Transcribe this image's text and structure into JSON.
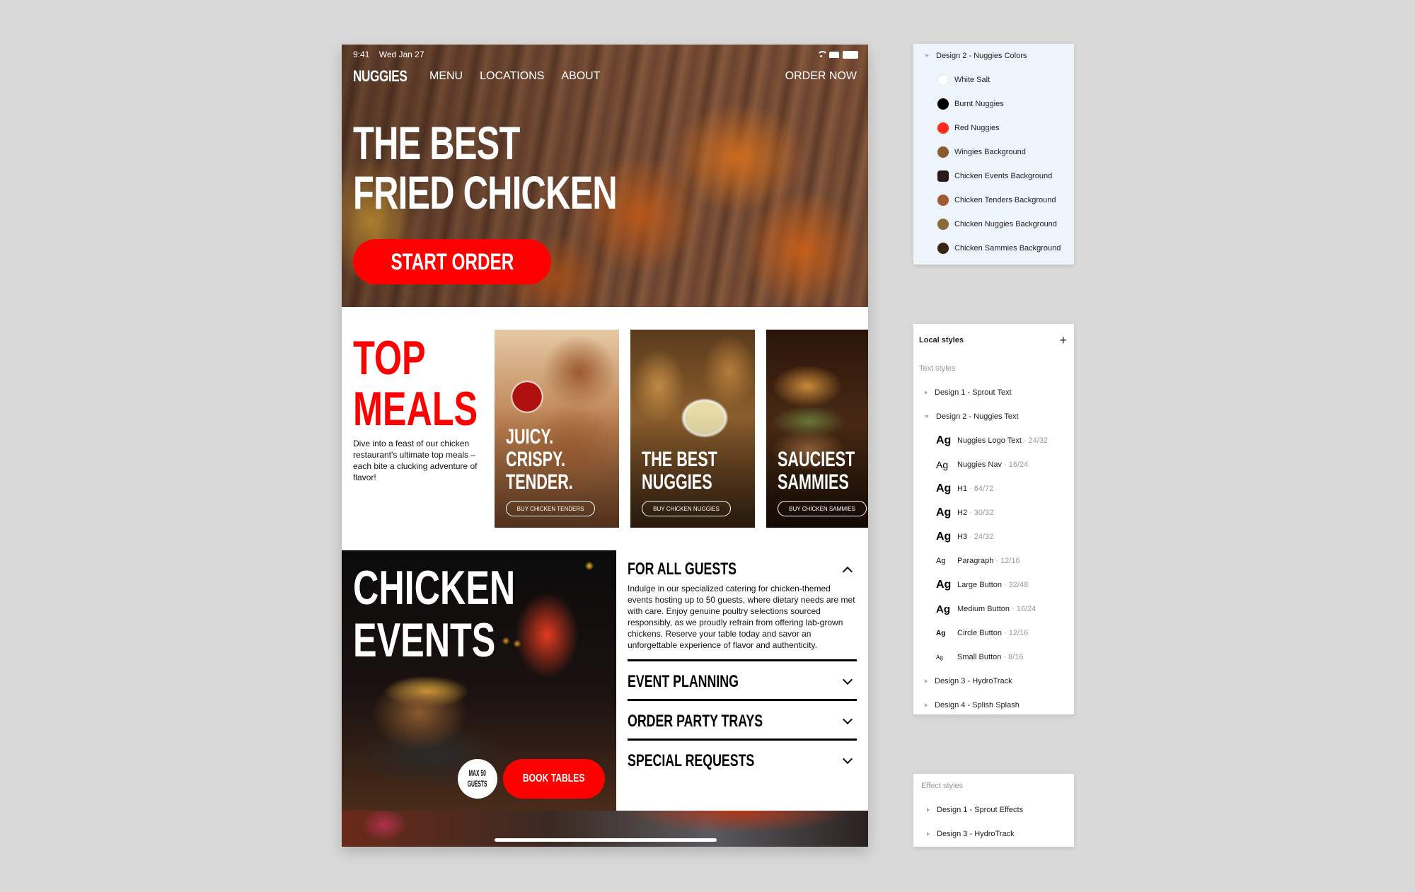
{
  "device": {
    "status_bar": {
      "time": "9:41",
      "date": "Wed Jan 27"
    },
    "nav": {
      "logo": "NUGGIES",
      "links": [
        "MENU",
        "LOCATIONS",
        "ABOUT"
      ],
      "cta": "ORDER NOW"
    },
    "hero": {
      "title_line1": "THE BEST",
      "title_line2": "FRIED CHICKEN",
      "button": "START ORDER"
    },
    "top_meals": {
      "title_line1": "TOP",
      "title_line2": "MEALS",
      "description": "Dive into a feast of our chicken restaurant's ultimate top meals – each bite a clucking adventure of flavor!",
      "cards": [
        {
          "title_lines": [
            "JUICY.",
            "CRISPY.",
            "TENDER."
          ],
          "button": "BUY CHICKEN TENDERS"
        },
        {
          "title_lines": [
            "THE BEST",
            "NUGGIES"
          ],
          "button": "BUY CHICKEN NUGGIES"
        },
        {
          "title_lines": [
            "SAUCIEST",
            "SAMMIES"
          ],
          "button": "BUY CHICKEN SAMMIES"
        }
      ]
    },
    "events": {
      "title_line1": "CHICKEN",
      "title_line2": "EVENTS",
      "badge_line1": "MAX 50",
      "badge_line2": "GUESTS",
      "button": "BOOK TABLES",
      "accordion": [
        {
          "title": "FOR ALL GUESTS",
          "open": true,
          "body": "Indulge in our specialized catering for chicken-themed events hosting up to 50 guests, where dietary needs are met with care. Enjoy genuine poultry selections sourced responsibly, as we proudly refrain from offering lab-grown chickens. Reserve your table today and savor an unforgettable experience of flavor and authenticity."
        },
        {
          "title": "EVENT PLANNING",
          "open": false
        },
        {
          "title": "ORDER PARTY TRAYS",
          "open": false
        },
        {
          "title": "SPECIAL REQUESTS",
          "open": false
        }
      ]
    }
  },
  "colors_panel": {
    "group": "Design 2 - Nuggies Colors",
    "items": [
      {
        "name": "White Salt",
        "color": "#ffffff"
      },
      {
        "name": "Burnt Nuggies",
        "color": "#000000"
      },
      {
        "name": "Red Nuggies",
        "color": "#ff2a1a"
      },
      {
        "name": "Wingies Background",
        "color": "#8a5a30"
      },
      {
        "name": "Chicken Events Background",
        "color": "#2a1a1a"
      },
      {
        "name": "Chicken Tenders Background",
        "color": "#a05a30"
      },
      {
        "name": "Chicken Nuggies Background",
        "color": "#8a6a3a"
      },
      {
        "name": "Chicken Sammies Background",
        "color": "#3a2414"
      }
    ]
  },
  "styles_panel": {
    "title": "Local styles",
    "section": "Text styles",
    "groups": [
      {
        "name": "Design 1 - Sprout Text",
        "expanded": false
      },
      {
        "name": "Design 2 - Nuggies Text",
        "expanded": true
      }
    ],
    "text_styles": [
      {
        "preview": "Ag",
        "name": "Nuggies Logo Text",
        "size": "24/32"
      },
      {
        "preview": "Ag",
        "name": "Nuggies Nav",
        "size": "16/24"
      },
      {
        "preview": "Ag",
        "name": "H1",
        "size": "64/72"
      },
      {
        "preview": "Ag",
        "name": "H2",
        "size": "30/32"
      },
      {
        "preview": "Ag",
        "name": "H3",
        "size": "24/32"
      },
      {
        "preview": "Ag",
        "name": "Paragraph",
        "size": "12/16"
      },
      {
        "preview": "Ag",
        "name": "Large Button",
        "size": "32/48"
      },
      {
        "preview": "Ag",
        "name": "Medium Button",
        "size": "16/24"
      },
      {
        "preview": "Ag",
        "name": "Circle Button",
        "size": "12/16"
      },
      {
        "preview": "Ag",
        "name": "Small Button",
        "size": "8/16"
      }
    ],
    "trailing_groups": [
      "Design 3 - HydroTrack",
      "Design 4 - Splish Splash"
    ]
  },
  "effect_panel": {
    "section": "Effect styles",
    "groups": [
      "Design 1 - Sprout Effects",
      "Design 3 - HydroTrack"
    ]
  }
}
